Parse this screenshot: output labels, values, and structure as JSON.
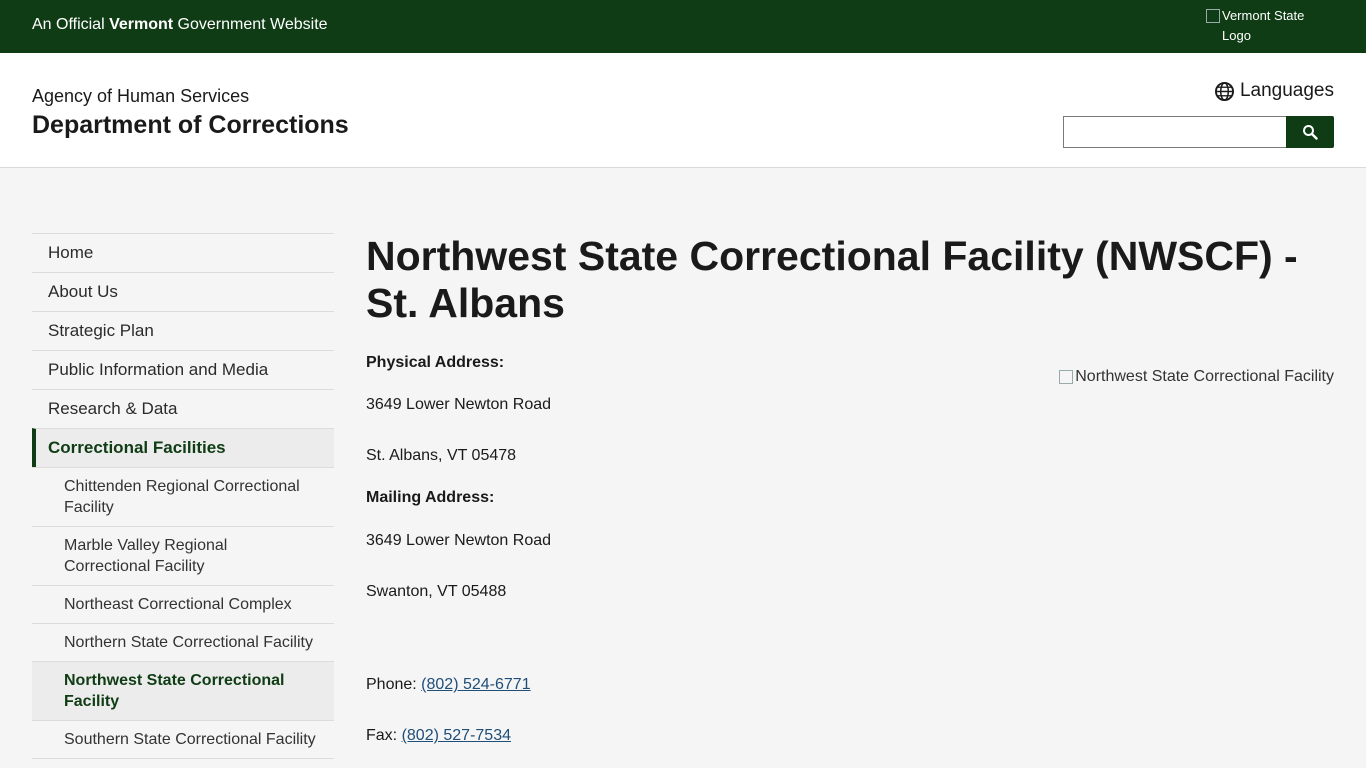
{
  "topbar": {
    "official_prefix": "An Official",
    "official_state": "Vermont",
    "official_suffix": "Government Website",
    "logo_alt": "Vermont State Logo"
  },
  "header": {
    "agency": "Agency of Human Services",
    "department": "Department of Corrections",
    "languages_label": "Languages",
    "search_placeholder": ""
  },
  "sidebar": {
    "items": [
      {
        "label": "Home"
      },
      {
        "label": "About Us"
      },
      {
        "label": "Strategic Plan"
      },
      {
        "label": "Public Information and Media"
      },
      {
        "label": "Research & Data"
      },
      {
        "label": "Correctional Facilities"
      }
    ],
    "subitems": [
      {
        "label": "Chittenden Regional Correctional Facility"
      },
      {
        "label": "Marble Valley Regional Correctional Facility"
      },
      {
        "label": "Northeast Correctional Complex"
      },
      {
        "label": "Northern State Correctional Facility"
      },
      {
        "label": "Northwest State Correctional Facility"
      },
      {
        "label": "Southern State Correctional Facility"
      }
    ]
  },
  "main": {
    "title": "Northwest State Correctional Facility (NWSCF) - St. Albans",
    "image_alt": "Northwest State Correctional Facility",
    "physical_label": "Physical Address:",
    "physical_line1": "3649 Lower Newton Road",
    "physical_line2": "St. Albans, VT 05478",
    "mailing_label": "Mailing Address:",
    "mailing_line1": "3649 Lower Newton Road",
    "mailing_line2": "Swanton, VT 05488",
    "phone_label": "Phone:",
    "phone": "(802) 524-6771",
    "fax_label": "Fax:",
    "fax": "(802) 527-7534"
  },
  "colors": {
    "brand_green": "#0f3c14",
    "link": "#1f4e79"
  },
  "icons": {
    "languages": "globe-icon",
    "search": "search-icon"
  }
}
